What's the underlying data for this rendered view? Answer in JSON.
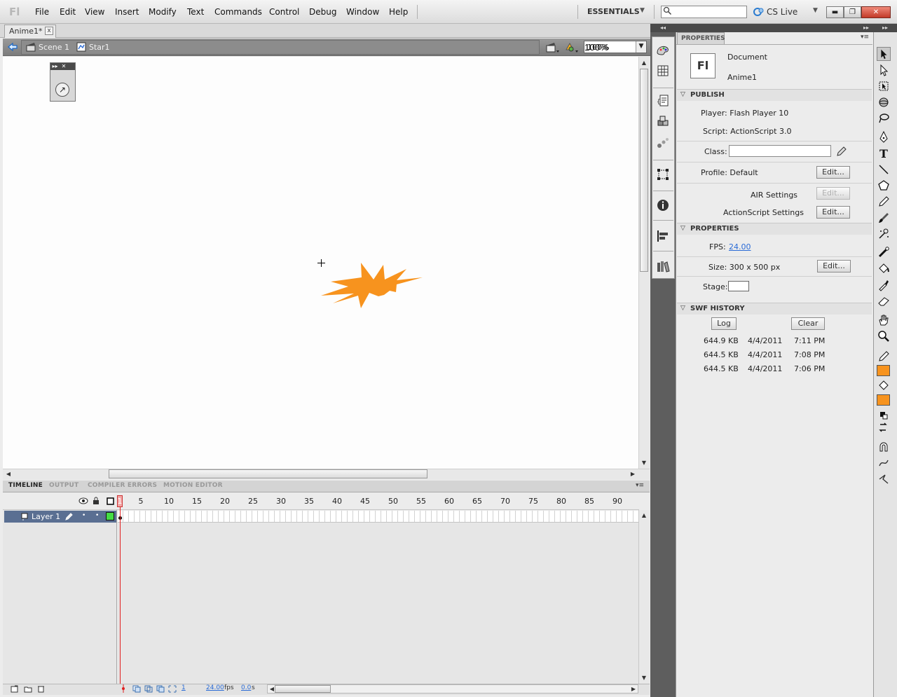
{
  "app": {
    "logo": "Fl"
  },
  "menu": [
    "File",
    "Edit",
    "View",
    "Insert",
    "Modify",
    "Text",
    "Commands",
    "Control",
    "Debug",
    "Window",
    "Help"
  ],
  "workspace": {
    "label": "ESSENTIALS",
    "arrow": "▼"
  },
  "search": {
    "placeholder": ""
  },
  "cs_live": {
    "label": "CS Live",
    "arrow": "▼"
  },
  "window_buttons": {
    "minimize": "▬",
    "restore": "❐",
    "close": "✕"
  },
  "document_tab": {
    "label": "Anime1*",
    "close": "x"
  },
  "edit_bar": {
    "scene": "Scene 1",
    "symbol": "Star1",
    "zoom": "100%"
  },
  "colors": {
    "star": "#f7931e",
    "stroke": "#f7931e",
    "fill": "#f7931e",
    "layer_color": "#44dd44",
    "playhead": "#e02020",
    "link": "#2a6bd6"
  },
  "timeline": {
    "tabs": [
      "TIMELINE",
      "OUTPUT",
      "COMPILER ERRORS",
      "MOTION EDITOR"
    ],
    "frame_numbers": [
      "1",
      "5",
      "10",
      "15",
      "20",
      "25",
      "30",
      "35",
      "40",
      "45",
      "50",
      "55",
      "60",
      "65",
      "70",
      "75",
      "80",
      "85",
      "90"
    ],
    "layer": {
      "name": "Layer 1"
    },
    "footer": {
      "frame": "1",
      "fps": "24.00",
      "fps_unit": "fps",
      "time": "0.0",
      "time_unit": "s"
    }
  },
  "properties": {
    "tab": "PROPERTIES",
    "doc_icon": "Fl",
    "doc_type": "Document",
    "doc_name": "Anime1",
    "publish": {
      "header": "PUBLISH",
      "player": "Player: Flash Player 10",
      "script": "Script: ActionScript 3.0",
      "class_label": "Class:",
      "class_value": "",
      "profile": "Profile: Default",
      "edit": "Edit...",
      "air_settings": "AIR Settings",
      "as_settings": "ActionScript Settings"
    },
    "props": {
      "header": "PROPERTIES",
      "fps_label": "FPS:",
      "fps_value": "24.00",
      "size": "Size: 300 x 500 px",
      "stage_label": "Stage:",
      "edit": "Edit..."
    },
    "swf_history": {
      "header": "SWF HISTORY",
      "log_btn": "Log",
      "clear_btn": "Clear",
      "rows": [
        {
          "size": "644.9 KB",
          "date": "4/4/2011",
          "time": "7:11 PM"
        },
        {
          "size": "644.5 KB",
          "date": "4/4/2011",
          "time": "7:08 PM"
        },
        {
          "size": "644.5 KB",
          "date": "4/4/2011",
          "time": "7:06 PM"
        }
      ]
    }
  }
}
